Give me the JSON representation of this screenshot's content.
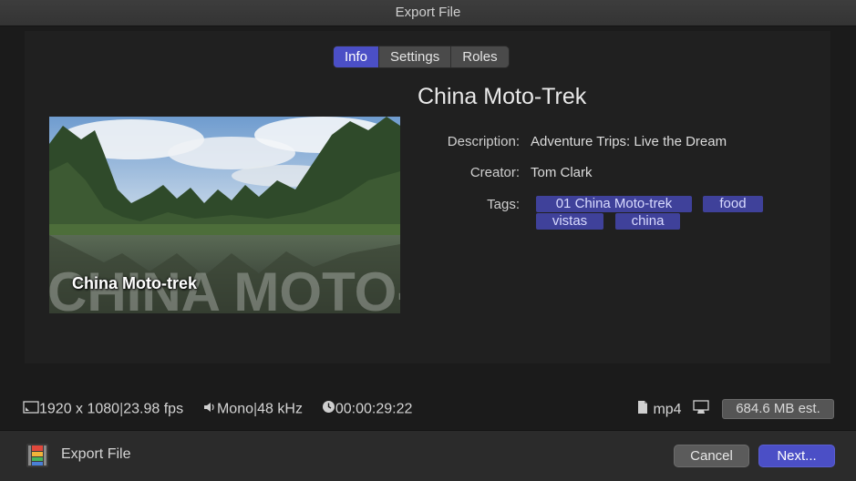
{
  "window": {
    "title": "Export File"
  },
  "tabs": [
    {
      "label": "Info",
      "active": true
    },
    {
      "label": "Settings",
      "active": false
    },
    {
      "label": "Roles",
      "active": false
    }
  ],
  "project": {
    "title": "China Moto-Trek",
    "thumbnail_caption": "China Moto-trek",
    "thumbnail_watermark": "CHINA MOTO-TREK"
  },
  "metadata": {
    "description_label": "Description:",
    "description_value": "Adventure Trips: Live the Dream",
    "creator_label": "Creator:",
    "creator_value": "Tom Clark",
    "tags_label": "Tags:",
    "tags": [
      "01 China Moto-trek",
      "food",
      "vistas",
      "china"
    ]
  },
  "media_info": {
    "resolution": "1920 x 1080",
    "frame_rate": "23.98 fps",
    "channels": "Mono",
    "sample_rate": "48 kHz",
    "duration": "00:00:29:22",
    "format": "mp4",
    "size_estimate": "684.6 MB est."
  },
  "footer": {
    "label": "Export File",
    "cancel_label": "Cancel",
    "next_label": "Next..."
  },
  "colors": {
    "accent": "#4b4fc6",
    "tag_bg": "#3f419a",
    "background": "#1e1e1e"
  }
}
